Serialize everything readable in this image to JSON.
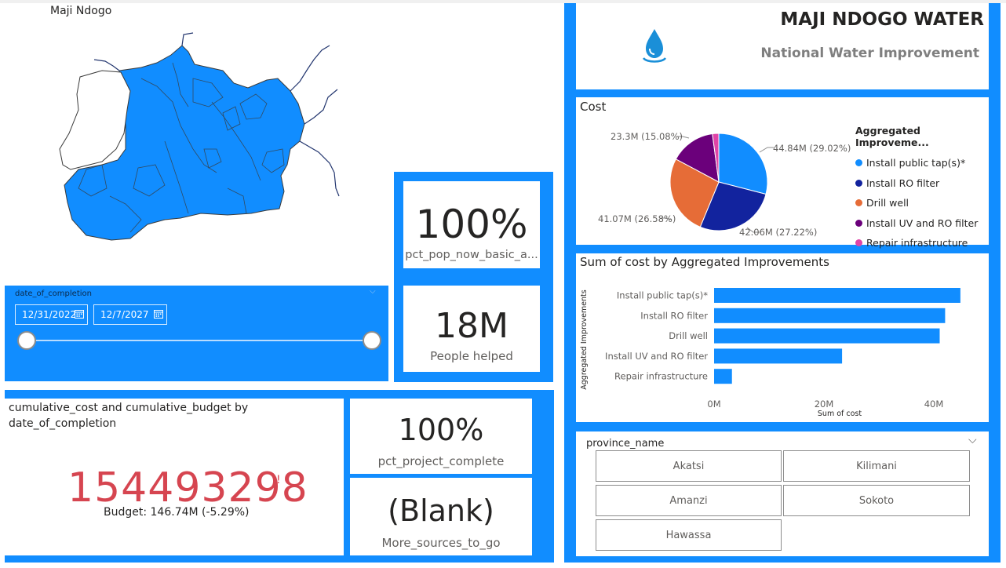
{
  "map": {
    "title": "Maji Ndogo"
  },
  "date_filter": {
    "label": "date_of_completion",
    "start": "12/31/2022",
    "end": "12/7/2027",
    "icon": "calendar-icon"
  },
  "kpis": {
    "pct_pop": {
      "value": "100%",
      "label": "pct_pop_now_basic_a..."
    },
    "people": {
      "value": "18M",
      "label": "People helped"
    },
    "pct_project": {
      "value": "100%",
      "label": "pct_project_complete"
    },
    "sources": {
      "value": "(Blank)",
      "label": "More_sources_to_go"
    }
  },
  "cumulative": {
    "title": "cumulative_cost and cumulative_budget by date_of_completion",
    "value": "154493298",
    "flag": "!",
    "budget": "Budget: 146.74M (-5.29%)"
  },
  "header": {
    "title": "MAJI NDOGO WATER",
    "subtitle": "National Water Improvement",
    "icon": "water-drop-icon"
  },
  "cost_chart": {
    "title": "Cost",
    "legend_title": "Aggregated Improveme...",
    "labels": {
      "public_tap": "44.84M (29.02%)",
      "ro": "42.06M (27.22%)",
      "drill": "41.07M (26.58%)",
      "uv": "23.3M (15.08%)"
    }
  },
  "bar_chart_meta": {
    "title": "Sum of cost by Aggregated Improvements",
    "ylabel": "Aggregated Improvements",
    "xlabel": "Sum of cost"
  },
  "province": {
    "label": "province_name",
    "items": [
      "Akatsi",
      "Kilimani",
      "Amanzi",
      "Sokoto",
      "Hawassa"
    ]
  },
  "colors": {
    "accent": "#118DFF",
    "tap": "#118DFF",
    "ro": "#12239E",
    "drill": "#E66C37",
    "uv": "#6B007B",
    "repair": "#E044A7",
    "negative": "#D64550"
  },
  "chart_data": [
    {
      "type": "pie",
      "categories": [
        "Install public tap(s)*",
        "Install RO filter",
        "Drill well",
        "Install UV and RO filter",
        "Repair infrastructure"
      ],
      "values": [
        44.84,
        42.06,
        41.07,
        23.3,
        3.25
      ],
      "title": "Cost",
      "legend_title": "Aggregated Improveme..."
    },
    {
      "type": "bar",
      "orientation": "horizontal",
      "categories": [
        "Install public tap(s)*",
        "Install RO filter",
        "Drill well",
        "Install UV and RO filter",
        "Repair infrastructure"
      ],
      "values": [
        44.84,
        42.06,
        41.07,
        23.3,
        3.25
      ],
      "title": "Sum of cost by Aggregated Improvements",
      "xlabel": "Sum of cost",
      "ylabel": "Aggregated Improvements",
      "xticks": [
        "0M",
        "20M",
        "40M"
      ],
      "xlim": [
        0,
        48
      ]
    }
  ]
}
